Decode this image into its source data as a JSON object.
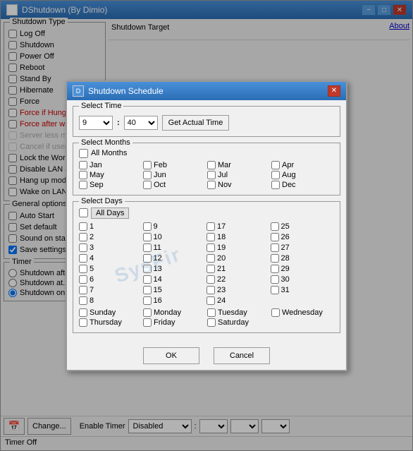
{
  "window": {
    "title": "DShutdown (By Dimio)",
    "icon": "D",
    "buttons": {
      "minimize": "−",
      "maximize": "□",
      "close": "✕"
    }
  },
  "left_panel": {
    "shutdown_type": {
      "title": "Shutdown Type",
      "items": [
        {
          "label": "Log Off",
          "checked": false,
          "disabled": false,
          "highlighted": false
        },
        {
          "label": "Shutdown",
          "checked": false,
          "disabled": false,
          "highlighted": false
        },
        {
          "label": "Power Off",
          "checked": false,
          "disabled": false,
          "highlighted": false
        },
        {
          "label": "Reboot",
          "checked": false,
          "disabled": false,
          "highlighted": false
        },
        {
          "label": "Stand By",
          "checked": false,
          "disabled": false,
          "highlighted": false
        },
        {
          "label": "Hibernate",
          "checked": false,
          "disabled": false,
          "highlighted": false
        },
        {
          "label": "Force",
          "checked": false,
          "disabled": false,
          "highlighted": false
        },
        {
          "label": "Force if Hung",
          "checked": false,
          "disabled": false,
          "highlighted": true
        },
        {
          "label": "Force after wait",
          "checked": false,
          "disabled": false,
          "highlighted": true
        },
        {
          "label": "Server less mode",
          "checked": false,
          "disabled": true,
          "highlighted": false
        },
        {
          "label": "Cancel if user is logg...",
          "checked": false,
          "disabled": true,
          "highlighted": false
        },
        {
          "label": "Lock the Workstatio...",
          "checked": false,
          "disabled": false,
          "highlighted": false
        },
        {
          "label": "Disable LAN adapte...",
          "checked": false,
          "disabled": false,
          "highlighted": false
        },
        {
          "label": "Hang up modem",
          "checked": false,
          "disabled": false,
          "highlighted": false
        },
        {
          "label": "Wake on LAN",
          "checked": false,
          "disabled": false,
          "highlighted": false
        }
      ]
    },
    "general_options": {
      "title": "General options",
      "items": [
        {
          "label": "Auto Start",
          "checked": false
        },
        {
          "label": "Set default",
          "checked": false
        },
        {
          "label": "Sound on start",
          "checked": false
        },
        {
          "label": "Save settings on exi...",
          "checked": true
        }
      ]
    },
    "timer": {
      "title": "Timer",
      "items": [
        {
          "label": "Shutdown after...",
          "selected": false
        },
        {
          "label": "Shutdown at...",
          "selected": false
        },
        {
          "label": "Shutdown on...",
          "selected": true
        }
      ]
    }
  },
  "right_panel": {
    "shutdown_target": "Shutdown Target",
    "about": "About"
  },
  "bottom": {
    "calendar_icon": "📅",
    "change_btn": "Change...",
    "enable_timer": "Enable Timer",
    "disabled_label": "Disabled",
    "status": "Timer Off"
  },
  "modal": {
    "title": "Shutdown Schedule",
    "icon": "D",
    "close_btn": "✕",
    "select_time": {
      "title": "Select Time",
      "hour": "9",
      "minute": "40",
      "separator": ":",
      "actual_time_btn": "Get Actual Time"
    },
    "select_months": {
      "title": "Select Months",
      "all_months_label": "All Months",
      "all_months_checked": false,
      "months": [
        {
          "label": "Jan",
          "checked": false
        },
        {
          "label": "Feb",
          "checked": false
        },
        {
          "label": "Mar",
          "checked": false
        },
        {
          "label": "Apr",
          "checked": false
        },
        {
          "label": "May",
          "checked": false
        },
        {
          "label": "Jun",
          "checked": false
        },
        {
          "label": "Jul",
          "checked": false
        },
        {
          "label": "Aug",
          "checked": false
        },
        {
          "label": "Sep",
          "checked": false
        },
        {
          "label": "Oct",
          "checked": false
        },
        {
          "label": "Nov",
          "checked": false
        },
        {
          "label": "Dec",
          "checked": false
        }
      ]
    },
    "select_days": {
      "title": "Select Days",
      "all_days_label": "All Days",
      "all_days_checked": false,
      "days": [
        "1",
        "2",
        "3",
        "4",
        "5",
        "6",
        "7",
        "8",
        "9",
        "10",
        "11",
        "12",
        "13",
        "14",
        "15",
        "16",
        "17",
        "18",
        "19",
        "20",
        "21",
        "22",
        "23",
        "24",
        "25",
        "26",
        "27",
        "28",
        "29",
        "30",
        "31",
        ""
      ],
      "weekdays": [
        {
          "label": "Sunday",
          "checked": false
        },
        {
          "label": "Monday",
          "checked": false
        },
        {
          "label": "Tuesday",
          "checked": false
        },
        {
          "label": "Wednesday",
          "checked": false
        },
        {
          "label": "Thursday",
          "checked": false
        },
        {
          "label": "Friday",
          "checked": false
        },
        {
          "label": "Saturday",
          "checked": false
        }
      ]
    },
    "ok_btn": "OK",
    "cancel_btn": "Cancel",
    "watermark": "SysFir"
  }
}
